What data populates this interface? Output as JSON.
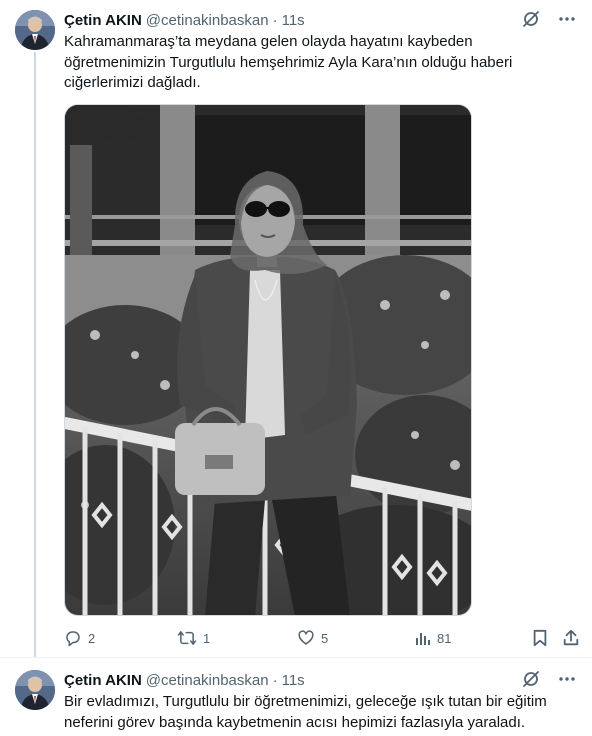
{
  "tweets": [
    {
      "author": {
        "name": "Çetin AKIN",
        "handle": "@cetinakinbaskan",
        "separator": "·",
        "time": "11s"
      },
      "text": "Kahramanmaraş’ta meydana gelen olayda hayatını kaybeden öğretmenimizin Turgutlulu hemşehrimiz Ayla Kara’nın olduğu haberi ciğerlerimizi dağladı.",
      "media": {
        "type": "black-and-white photo",
        "description": "woman with headscarf and sunglasses seated on a white railing holding a handbag, garden behind"
      },
      "stats": {
        "replies": "2",
        "retweets": "1",
        "likes": "5",
        "views": "81"
      }
    },
    {
      "author": {
        "name": "Çetin AKIN",
        "handle": "@cetinakinbaskan",
        "separator": "·",
        "time": "11s"
      },
      "text": "Bir evladımızı, Turgutlulu bir öğretmenimizi, geleceğe ışık tutan bir eğitim neferini görev başında kaybetmenin acısı hepimizi fazlasıyla yaraladı."
    }
  ],
  "icons": {
    "grok": "grok-icon",
    "more": "more-icon",
    "reply": "reply-icon",
    "retweet": "retweet-icon",
    "like": "heart-icon",
    "views": "views-icon",
    "bookmark": "bookmark-icon",
    "share": "share-icon"
  },
  "colors": {
    "text": "#0f1419",
    "secondary": "#536471",
    "border": "#cfd9de"
  }
}
